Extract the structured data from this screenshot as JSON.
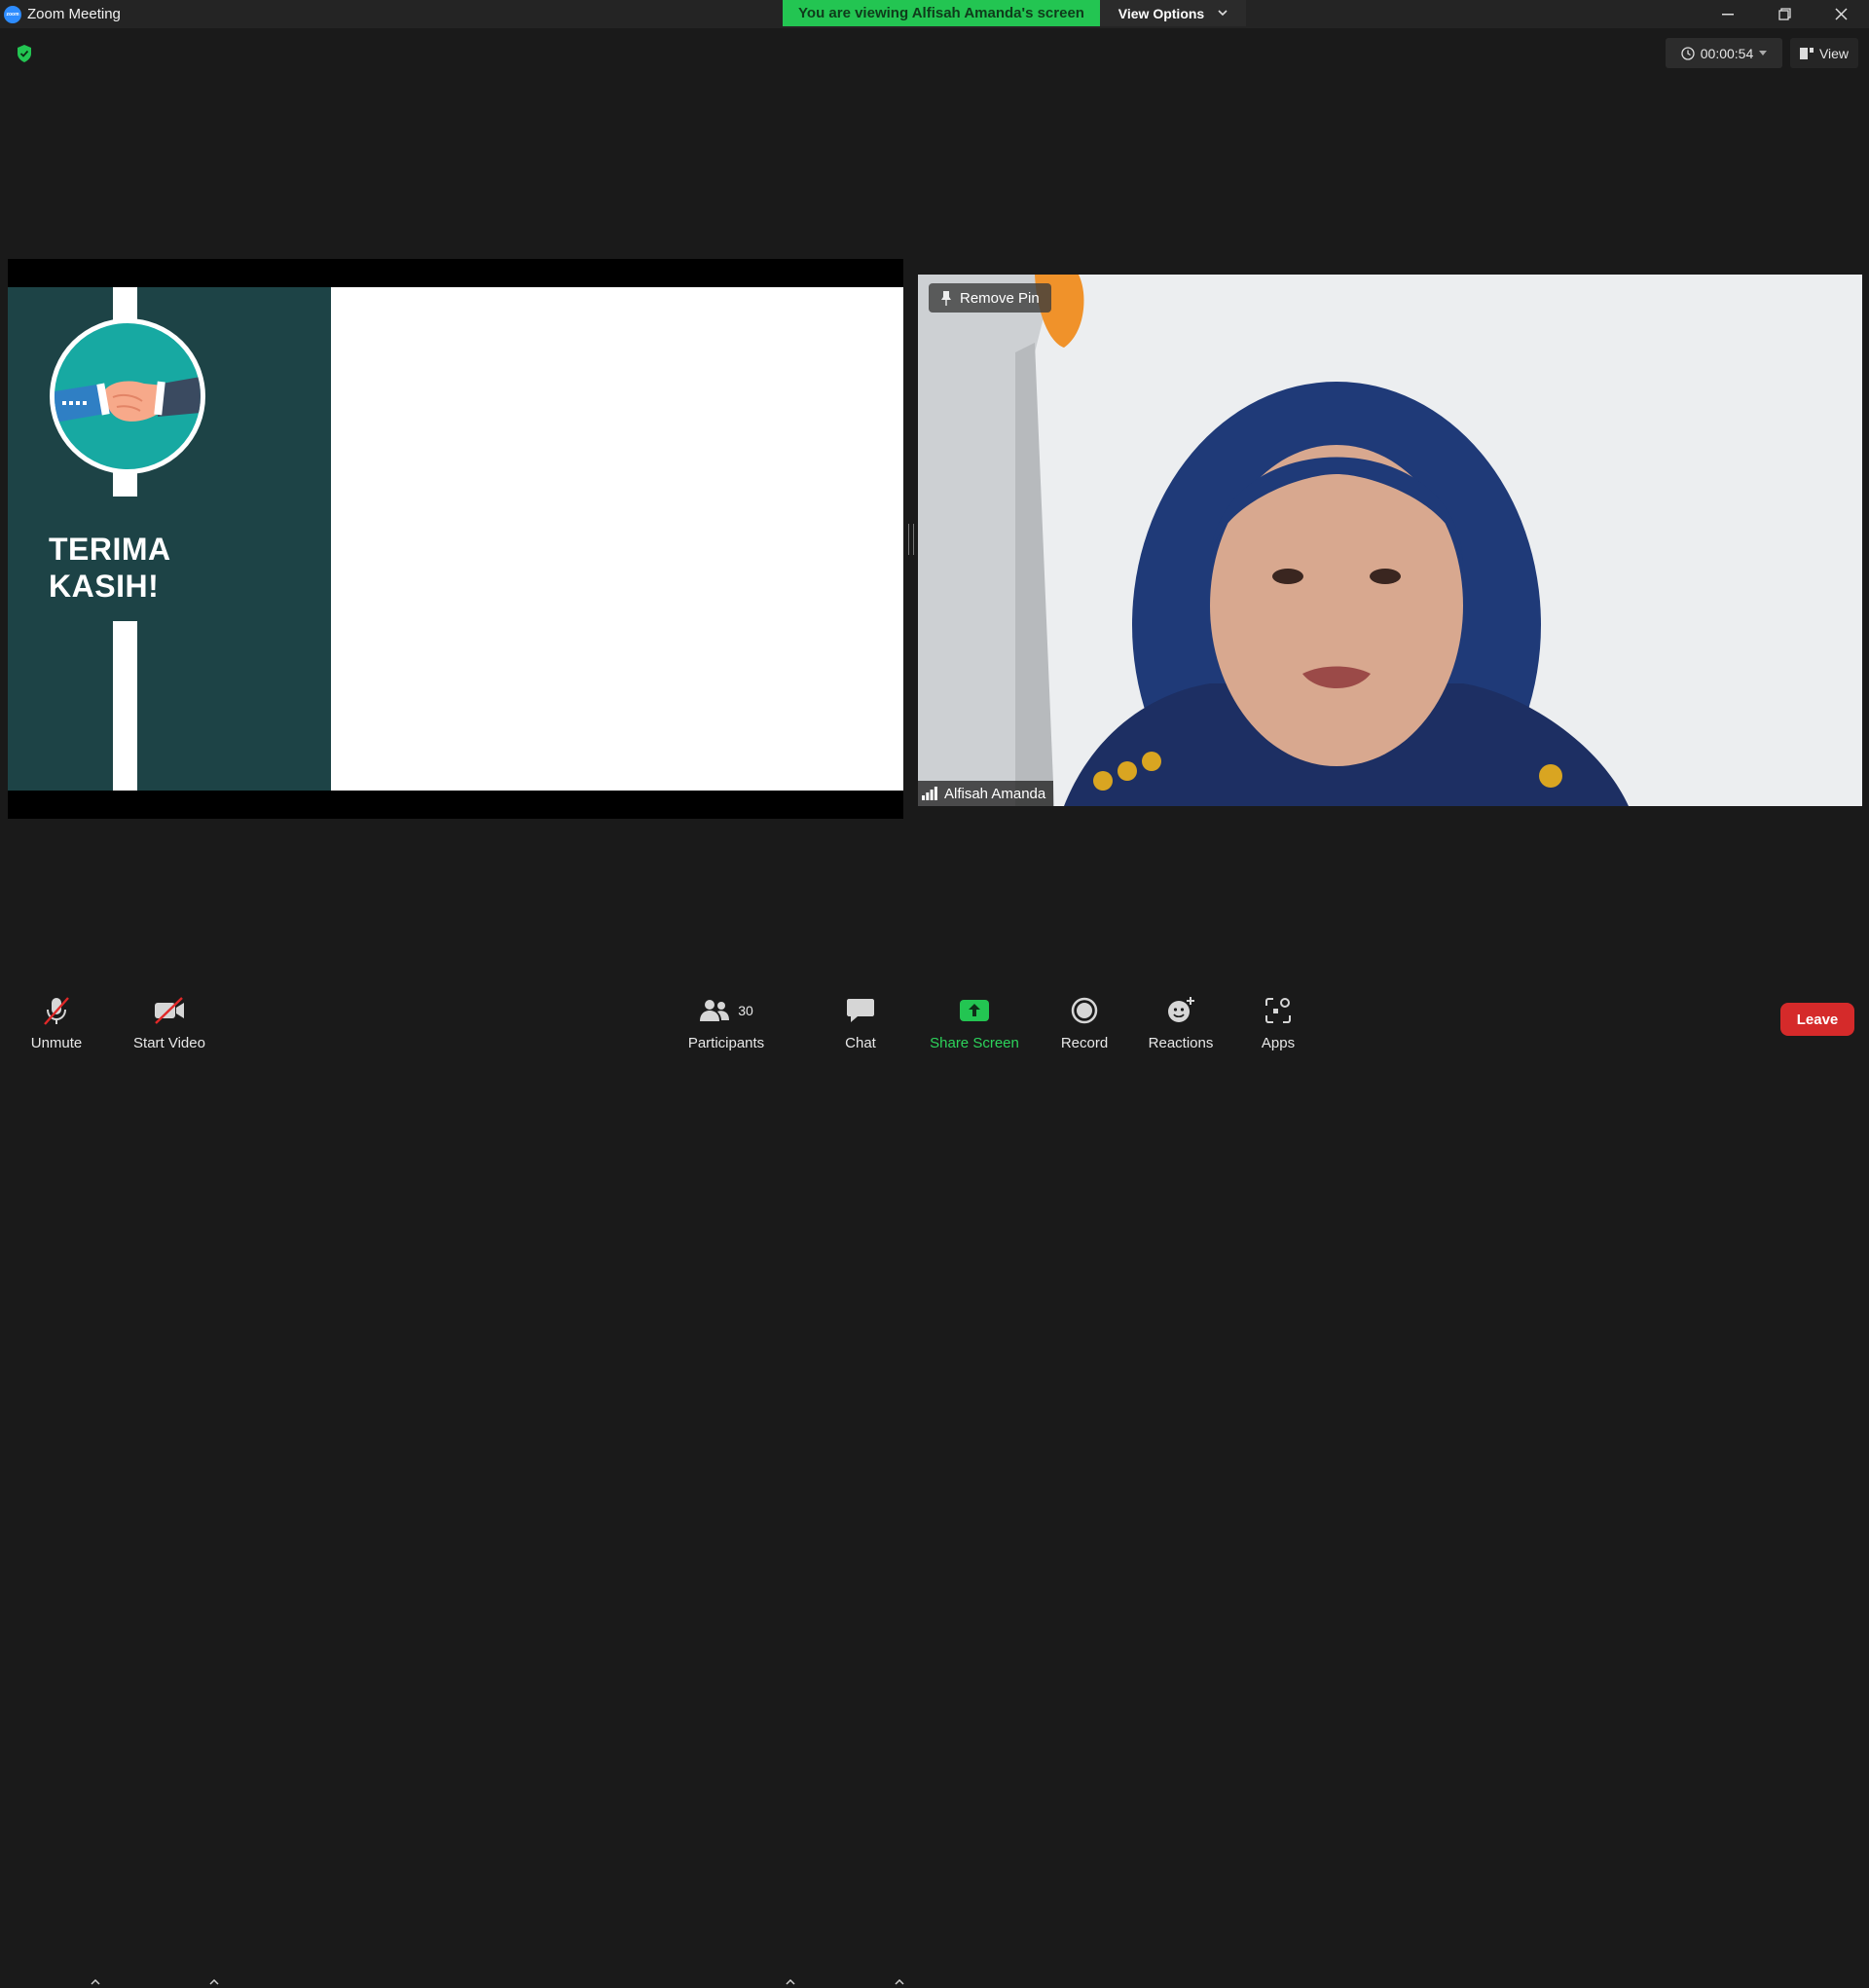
{
  "window": {
    "title": "Zoom Meeting",
    "logo_text": "zoom"
  },
  "banner": {
    "text": "You are viewing Alfisah Amanda's screen",
    "color": "#23c552"
  },
  "view_options": {
    "label": "View Options"
  },
  "top_right": {
    "timer": "00:00:54",
    "view_label": "View"
  },
  "slide": {
    "title": "TERIMA\nKASIH!",
    "panel_color": "#1d4346",
    "circle_color": "#17a9a2"
  },
  "video": {
    "remove_pin_label": "Remove Pin",
    "participant_name": "Alfisah Amanda"
  },
  "toolbar": {
    "unmute": "Unmute",
    "start_video": "Start Video",
    "participants": "Participants",
    "participants_count": "30",
    "chat": "Chat",
    "share_screen": "Share Screen",
    "record": "Record",
    "reactions": "Reactions",
    "apps": "Apps",
    "leave": "Leave"
  },
  "icons": {
    "security": "shield-check-icon",
    "mic": "mic-muted-icon",
    "video": "video-off-icon",
    "participants": "people-icon",
    "chat": "chat-bubble-icon",
    "share": "share-up-arrow-icon",
    "record": "record-icon",
    "reactions": "smiley-plus-icon",
    "apps": "apps-grid-icon"
  }
}
